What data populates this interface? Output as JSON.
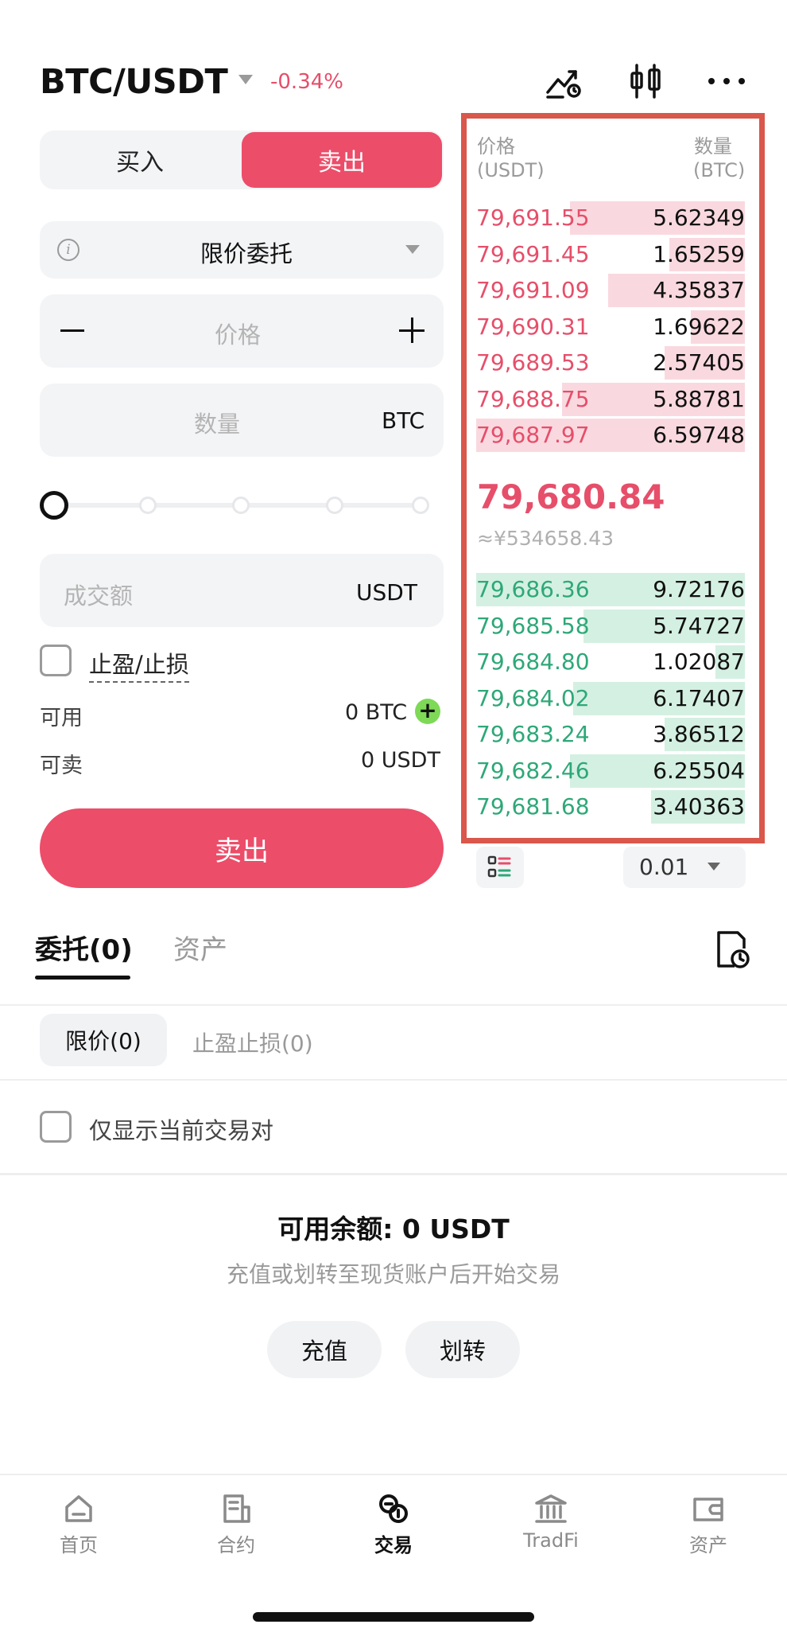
{
  "header": {
    "pair": "BTC/USDT",
    "change": "-0.34%",
    "icons": [
      "price-alert-icon",
      "candlestick-chart-icon",
      "more-icon"
    ]
  },
  "trade_form": {
    "buy_label": "买入",
    "sell_label": "卖出",
    "order_type": "限价委托",
    "price_placeholder": "价格",
    "quantity_placeholder": "数量",
    "quantity_unit": "BTC",
    "amount_placeholder": "成交额",
    "amount_unit": "USDT",
    "slider_percent": 0,
    "tpsl_label": "止盈/止损",
    "available_label": "可用",
    "available_value": "0 BTC",
    "sellable_label": "可卖",
    "sellable_value": "0 USDT",
    "submit_label": "卖出"
  },
  "order_book": {
    "price_header": "价格",
    "price_unit": "(USDT)",
    "qty_header": "数量",
    "qty_unit": "(BTC)",
    "asks": [
      {
        "price": "79,691.55",
        "qty": "5.62349",
        "depth": 0.65
      },
      {
        "price": "79,691.45",
        "qty": "1.65259",
        "depth": 0.28
      },
      {
        "price": "79,691.09",
        "qty": "4.35837",
        "depth": 0.51
      },
      {
        "price": "79,690.31",
        "qty": "1.69622",
        "depth": 0.2
      },
      {
        "price": "79,689.53",
        "qty": "2.57405",
        "depth": 0.3
      },
      {
        "price": "79,688.75",
        "qty": "5.88781",
        "depth": 0.68
      },
      {
        "price": "79,687.97",
        "qty": "6.59748",
        "depth": 1.0
      }
    ],
    "last_price": "79,680.84",
    "last_price_cny": "≈¥534658.43",
    "bids": [
      {
        "price": "79,686.36",
        "qty": "9.72176",
        "depth": 1.0
      },
      {
        "price": "79,685.58",
        "qty": "5.74727",
        "depth": 0.6
      },
      {
        "price": "79,684.80",
        "qty": "1.02087",
        "depth": 0.11
      },
      {
        "price": "79,684.02",
        "qty": "6.17407",
        "depth": 0.64
      },
      {
        "price": "79,683.24",
        "qty": "3.86512",
        "depth": 0.3
      },
      {
        "price": "79,682.46",
        "qty": "6.25504",
        "depth": 0.65
      },
      {
        "price": "79,681.68",
        "qty": "3.40363",
        "depth": 0.35
      }
    ],
    "precision": "0.01"
  },
  "tabs": {
    "orders": "委托(0)",
    "assets": "资产"
  },
  "subtabs": {
    "limit": "限价(0)",
    "tpsl": "止盈止损(0)"
  },
  "filter": {
    "current_pair_only": "仅显示当前交易对"
  },
  "balance": {
    "title": "可用余额: 0 USDT",
    "subtitle": "充值或划转至现货账户后开始交易",
    "deposit": "充值",
    "transfer": "划转"
  },
  "nav": [
    {
      "label": "首页",
      "icon": "home-icon"
    },
    {
      "label": "合约",
      "icon": "contract-icon"
    },
    {
      "label": "交易",
      "icon": "trade-icon"
    },
    {
      "label": "TradFi",
      "icon": "bank-icon"
    },
    {
      "label": "资产",
      "icon": "wallet-icon"
    }
  ],
  "colors": {
    "sell": "#ec4d69",
    "ask_text": "#e64e6a",
    "bid_text": "#2ea878",
    "ask_depth": "#f9d9df",
    "bid_depth": "#d4f0e2",
    "highlight_frame": "#d9574b"
  }
}
